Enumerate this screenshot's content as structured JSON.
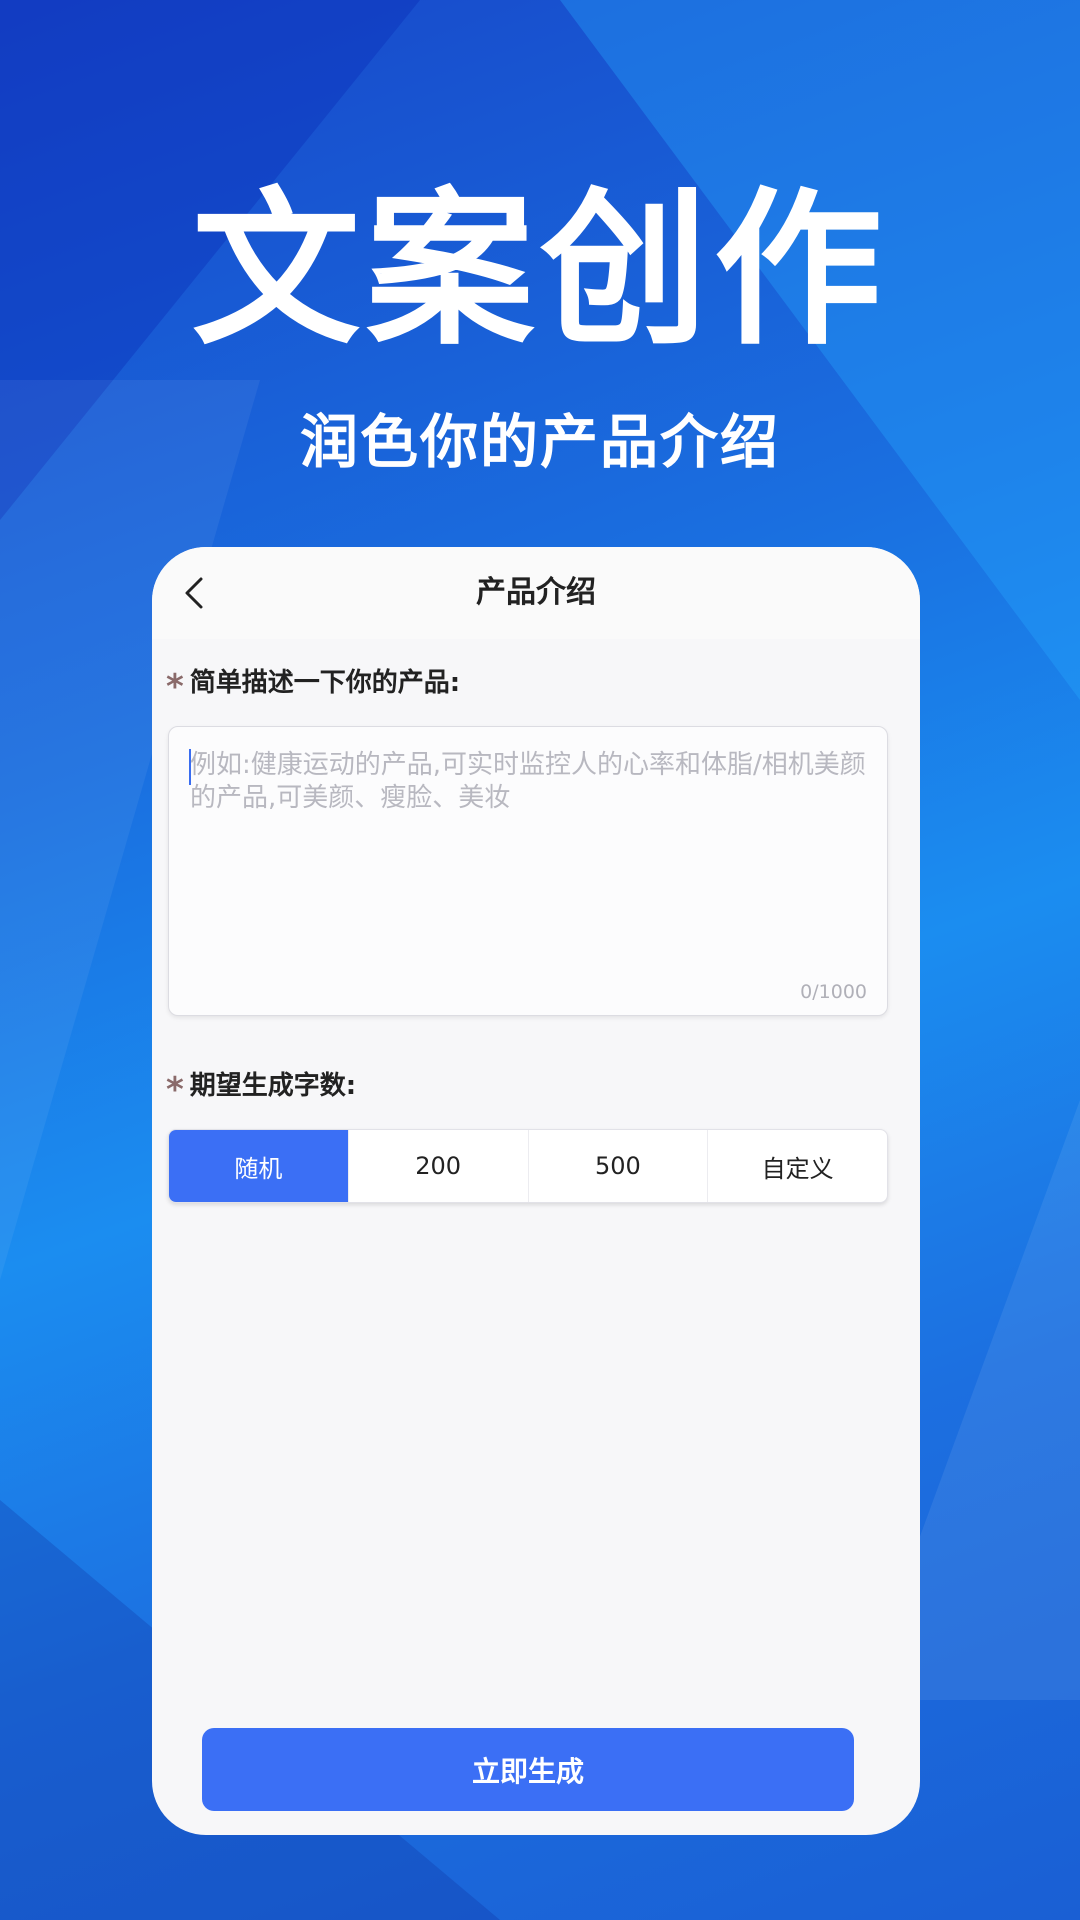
{
  "hero": {
    "title": "文案创作",
    "subtitle": "润色你的产品介绍"
  },
  "screen": {
    "nav": {
      "back_icon": "chevron-left-icon",
      "title": "产品介绍"
    },
    "description": {
      "required_mark": "*",
      "label": "简单描述一下你的产品:",
      "value": "",
      "placeholder": "例如:健康运动的产品,可实时监控人的心率和体脂/相机美颜的产品,可美颜、瘦脸、美妆",
      "counter": "0/1000"
    },
    "word_count": {
      "required_mark": "*",
      "label": "期望生成字数:",
      "options": [
        "随机",
        "200",
        "500",
        "自定义"
      ],
      "selected": "随机"
    },
    "generate_label": "立即生成"
  },
  "colors": {
    "accent": "#3b6ff5",
    "card": "#f7f7f9"
  }
}
